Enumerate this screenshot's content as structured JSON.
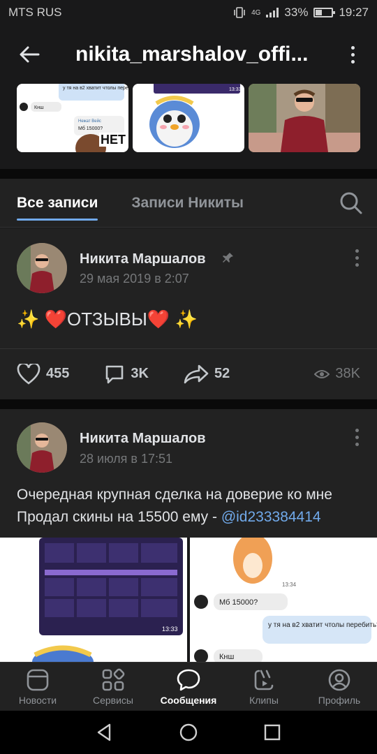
{
  "status": {
    "carrier": "MTS RUS",
    "network": "4G",
    "battery": "33%",
    "time": "19:27"
  },
  "header": {
    "title": "nikita_marshalov_offi..."
  },
  "tabs": {
    "all": "Все записи",
    "own": "Записи Никиты"
  },
  "posts": [
    {
      "author": "Никита Маршалов",
      "date": "29 мая 2019 в 2:07",
      "text_prefix": "✨ ❤️",
      "text_main": "ОТЗЫВЫ",
      "text_suffix": "❤️ ✨",
      "pinned": true,
      "likes": "455",
      "comments": "3K",
      "shares": "52",
      "views": "38K"
    },
    {
      "author": "Никита Маршалов",
      "date": "28 июля в 17:51",
      "line1": "Очередная крупная сделка на доверие ко мне",
      "line2": "Продал скины на 15500 ему - ",
      "mention": "@id233384414"
    }
  ],
  "chat_snippets": {
    "q": "у тя на в2 хватит чтолы перебить?",
    "name": "Нежат Вейс",
    "m6": "Мб 15000?",
    "net": "НЕТ",
    "knsh": "Кнш",
    "time1": "13:34",
    "time2": "13:33"
  },
  "nav": [
    {
      "label": "Новости",
      "icon": "news-icon"
    },
    {
      "label": "Сервисы",
      "icon": "services-icon"
    },
    {
      "label": "Сообщения",
      "icon": "messages-icon"
    },
    {
      "label": "Клипы",
      "icon": "clips-icon"
    },
    {
      "label": "Профиль",
      "icon": "profile-icon"
    }
  ],
  "colors": {
    "accent": "#71aaeb",
    "bg": "#19191a",
    "card": "#222222",
    "heart": "#e64646"
  }
}
